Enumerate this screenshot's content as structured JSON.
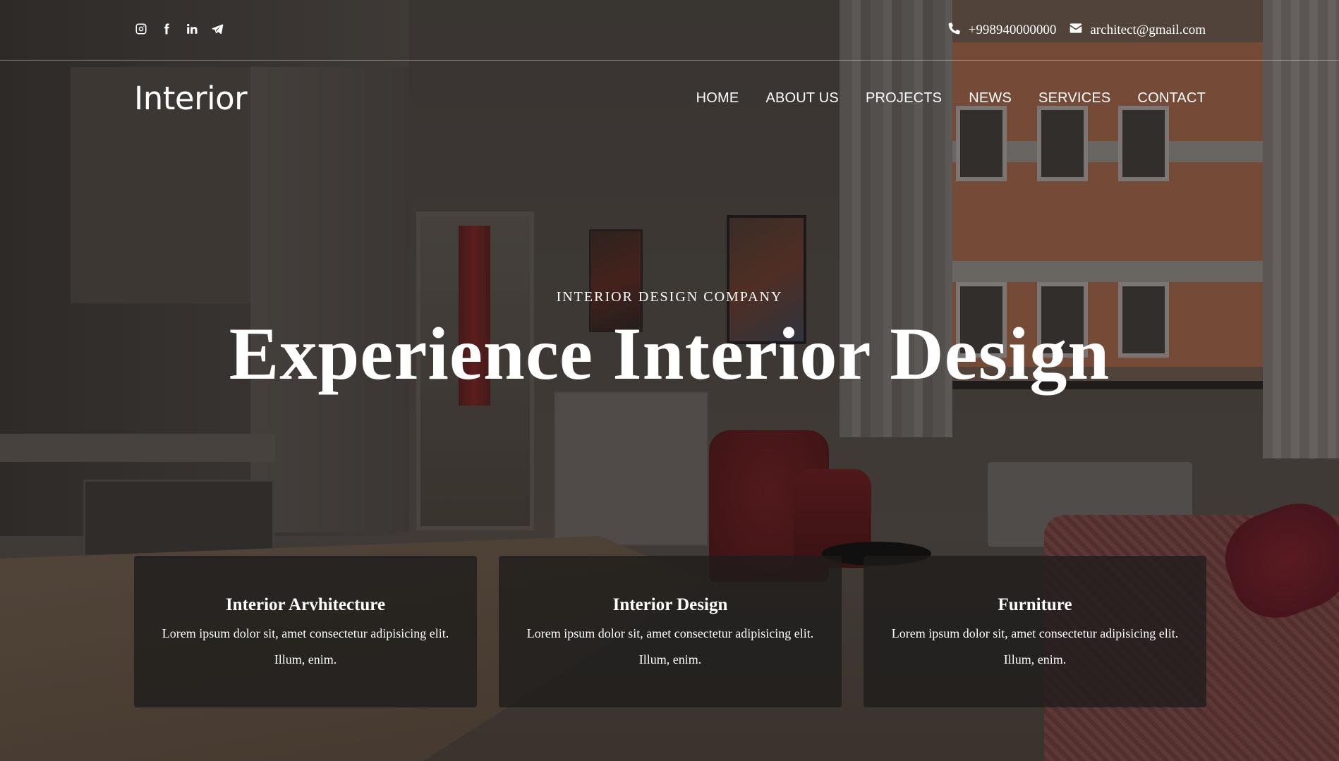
{
  "topbar": {
    "social_icons": [
      "instagram-icon",
      "facebook-icon",
      "linkedin-icon",
      "telegram-icon"
    ],
    "phone": "+998940000000",
    "email": "architect@gmail.com"
  },
  "navbar": {
    "logo": "Interior",
    "items": [
      {
        "label": "HOME"
      },
      {
        "label": "ABOUT US"
      },
      {
        "label": "PROJECTS"
      },
      {
        "label": "NEWS"
      },
      {
        "label": "SERVICES"
      },
      {
        "label": "CONTACT"
      }
    ]
  },
  "hero": {
    "subtitle": "INTERIOR DESIGN COMPANY",
    "title": "Experience Interior Design"
  },
  "services": [
    {
      "title": "Interior Arvhitecture",
      "text": "Lorem ipsum dolor sit, amet consectetur adipisicing elit. Illum, enim."
    },
    {
      "title": "Interior Design",
      "text": "Lorem ipsum dolor sit, amet consectetur adipisicing elit. Illum, enim."
    },
    {
      "title": "Furniture",
      "text": "Lorem ipsum dolor sit, amet consectetur adipisicing elit. Illum, enim."
    }
  ],
  "colors": {
    "text": "#ffffff",
    "card_background": "#1e1c1b"
  }
}
